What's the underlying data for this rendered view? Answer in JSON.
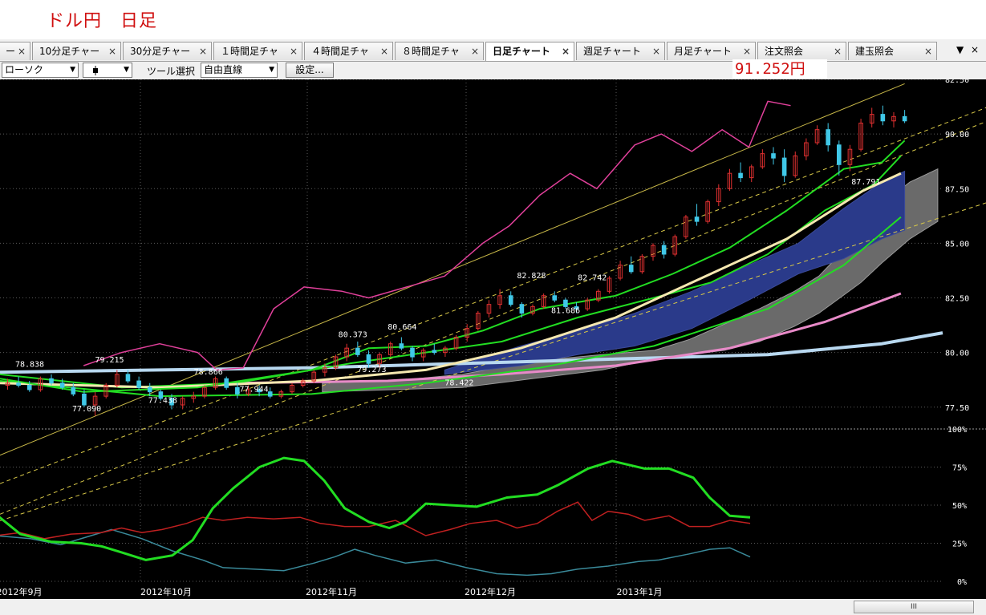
{
  "title": "ドル円　日足",
  "tabs": [
    {
      "label": "ー",
      "close": "×"
    },
    {
      "label": "10分足チャー",
      "close": "×"
    },
    {
      "label": "30分足チャー",
      "close": "×"
    },
    {
      "label": "１時間足チャ",
      "close": "×"
    },
    {
      "label": "４時間足チャ",
      "close": "×"
    },
    {
      "label": "８時間足チャ",
      "close": "×"
    },
    {
      "label": "日足チャート",
      "close": "×"
    },
    {
      "label": "週足チャート",
      "close": "×"
    },
    {
      "label": "月足チャート",
      "close": "×"
    },
    {
      "label": "注文照会",
      "close": "×"
    },
    {
      "label": "建玉照会",
      "close": "×"
    }
  ],
  "tab_menu_icon": "▼",
  "tab_close_all_icon": "×",
  "toolbar": {
    "chart_type": "ローソク",
    "candle_icon": "candlestick-icon",
    "tool_label": "ツール選択",
    "tool_value": "自由直線",
    "settings_label": "設定..."
  },
  "current_price": "91.252円",
  "scrollbar_grip": "III",
  "colors": {
    "bull": "#e03030",
    "bear": "#40c8e8",
    "cloud": "#6a6a6a",
    "band": "#2a3a8a",
    "ma_green": "#22dd22",
    "ma_cream": "#f5e8b0",
    "ma_pink": "#e88ac8",
    "ma_lightblue": "#b8d8f0",
    "rci_line": "#e0409a",
    "trend": "#c8b848",
    "osc_green": "#22dd22",
    "osc_red": "#c02020",
    "osc_teal": "#3a8a9a"
  },
  "chart_data": {
    "type": "line",
    "price_axis": {
      "ticks": [
        "82.50",
        "90.00",
        "87.50",
        "85.00",
        "82.50",
        "80.00",
        "77.50"
      ],
      "range": [
        76.5,
        92.5
      ]
    },
    "osc_axis": {
      "ticks": [
        "100%",
        "75%",
        "50%",
        "25%",
        "0%"
      ],
      "range": [
        0,
        100
      ]
    },
    "x_labels": [
      "2012年9月",
      "2012年10月",
      "2012年11月",
      "2012年12月",
      "2013年1月"
    ],
    "annotations": [
      {
        "text": "78.838",
        "t": 2,
        "v": 79.35
      },
      {
        "text": "79.215",
        "t": 23,
        "v": 79.55
      },
      {
        "text": "77.090",
        "t": 17,
        "v": 77.3
      },
      {
        "text": "78.866",
        "t": 49,
        "v": 79.0
      },
      {
        "text": "77.438",
        "t": 37,
        "v": 77.7
      },
      {
        "text": "77.944",
        "t": 61,
        "v": 78.2
      },
      {
        "text": "80.373",
        "t": 87,
        "v": 80.7
      },
      {
        "text": "80.664",
        "t": 100,
        "v": 81.05
      },
      {
        "text": "79.273",
        "t": 92,
        "v": 79.1
      },
      {
        "text": "78.422",
        "t": 115,
        "v": 78.5
      },
      {
        "text": "82.828",
        "t": 134,
        "v": 83.4
      },
      {
        "text": "82.742",
        "t": 150,
        "v": 83.3
      },
      {
        "text": "81.686",
        "t": 143,
        "v": 81.8
      },
      {
        "text": "87.791",
        "t": 222,
        "v": 87.7
      }
    ],
    "candles_ohlc": [
      [
        78.5,
        78.8,
        78.3,
        78.6
      ],
      [
        78.6,
        78.9,
        78.4,
        78.5
      ],
      [
        78.5,
        78.7,
        78.2,
        78.3
      ],
      [
        78.3,
        78.9,
        78.2,
        78.8
      ],
      [
        78.8,
        79.0,
        78.5,
        78.6
      ],
      [
        78.6,
        78.8,
        78.3,
        78.4
      ],
      [
        78.4,
        78.6,
        78.0,
        78.1
      ],
      [
        78.1,
        78.3,
        77.5,
        77.6
      ],
      [
        77.6,
        78.2,
        77.1,
        78.0
      ],
      [
        78.0,
        78.6,
        77.9,
        78.5
      ],
      [
        78.5,
        79.2,
        78.4,
        79.0
      ],
      [
        79.0,
        79.2,
        78.6,
        78.7
      ],
      [
        78.7,
        78.9,
        78.3,
        78.4
      ],
      [
        78.4,
        78.6,
        78.0,
        78.2
      ],
      [
        78.2,
        78.3,
        77.8,
        77.9
      ],
      [
        77.9,
        78.1,
        77.4,
        77.6
      ],
      [
        77.6,
        78.0,
        77.4,
        77.9
      ],
      [
        77.9,
        78.2,
        77.7,
        78.0
      ],
      [
        78.0,
        78.5,
        77.9,
        78.4
      ],
      [
        78.4,
        78.9,
        78.3,
        78.8
      ],
      [
        78.8,
        78.9,
        78.3,
        78.4
      ],
      [
        78.4,
        78.6,
        77.9,
        78.1
      ],
      [
        78.1,
        78.5,
        78.0,
        78.3
      ],
      [
        78.3,
        78.5,
        78.0,
        78.2
      ],
      [
        78.2,
        78.4,
        77.9,
        78.0
      ],
      [
        78.0,
        78.3,
        77.9,
        78.2
      ],
      [
        78.2,
        78.6,
        78.1,
        78.5
      ],
      [
        78.5,
        78.8,
        78.4,
        78.7
      ],
      [
        78.7,
        79.2,
        78.6,
        79.1
      ],
      [
        79.1,
        79.5,
        78.9,
        79.3
      ],
      [
        79.3,
        79.9,
        79.2,
        79.8
      ],
      [
        79.8,
        80.4,
        79.6,
        80.2
      ],
      [
        80.2,
        80.5,
        79.8,
        79.9
      ],
      [
        79.9,
        80.1,
        79.3,
        79.5
      ],
      [
        79.5,
        80.0,
        79.3,
        79.9
      ],
      [
        79.9,
        80.5,
        79.8,
        80.4
      ],
      [
        80.4,
        80.7,
        80.1,
        80.2
      ],
      [
        80.2,
        80.3,
        79.6,
        79.8
      ],
      [
        79.8,
        80.2,
        79.6,
        80.1
      ],
      [
        80.1,
        80.4,
        79.9,
        80.0
      ],
      [
        80.0,
        80.3,
        79.8,
        80.2
      ],
      [
        80.2,
        80.8,
        80.1,
        80.7
      ],
      [
        80.7,
        81.3,
        80.5,
        81.1
      ],
      [
        81.1,
        81.9,
        81.0,
        81.8
      ],
      [
        81.8,
        82.4,
        81.6,
        82.2
      ],
      [
        82.2,
        82.9,
        82.0,
        82.6
      ],
      [
        82.6,
        82.8,
        82.1,
        82.2
      ],
      [
        82.2,
        82.3,
        81.6,
        81.8
      ],
      [
        81.8,
        82.2,
        81.7,
        82.1
      ],
      [
        82.1,
        82.7,
        82.0,
        82.6
      ],
      [
        82.6,
        82.8,
        82.3,
        82.4
      ],
      [
        82.4,
        82.5,
        82.0,
        82.1
      ],
      [
        82.1,
        82.3,
        81.8,
        82.0
      ],
      [
        82.0,
        82.5,
        81.9,
        82.4
      ],
      [
        82.4,
        82.9,
        82.3,
        82.8
      ],
      [
        82.8,
        83.5,
        82.7,
        83.4
      ],
      [
        83.4,
        84.2,
        83.3,
        84.0
      ],
      [
        84.0,
        84.4,
        83.6,
        83.7
      ],
      [
        83.7,
        84.5,
        83.6,
        84.4
      ],
      [
        84.4,
        85.0,
        84.2,
        84.9
      ],
      [
        84.9,
        85.1,
        84.3,
        84.5
      ],
      [
        84.5,
        85.4,
        84.4,
        85.3
      ],
      [
        85.3,
        86.3,
        85.2,
        86.2
      ],
      [
        86.2,
        86.8,
        85.8,
        86.0
      ],
      [
        86.0,
        87.0,
        85.9,
        86.9
      ],
      [
        86.9,
        87.7,
        86.7,
        87.5
      ],
      [
        87.5,
        88.4,
        87.4,
        88.2
      ],
      [
        88.2,
        88.7,
        87.8,
        88.0
      ],
      [
        88.0,
        88.6,
        87.8,
        88.5
      ],
      [
        88.5,
        89.3,
        88.4,
        89.1
      ],
      [
        89.1,
        89.4,
        88.6,
        88.9
      ],
      [
        88.9,
        89.3,
        87.8,
        88.1
      ],
      [
        88.1,
        89.2,
        88.0,
        89.0
      ],
      [
        89.0,
        89.8,
        88.8,
        89.6
      ],
      [
        89.6,
        90.4,
        89.5,
        90.2
      ],
      [
        90.2,
        90.5,
        89.2,
        89.5
      ],
      [
        89.5,
        89.7,
        88.1,
        88.6
      ],
      [
        88.6,
        89.5,
        88.3,
        89.3
      ],
      [
        89.3,
        90.7,
        89.2,
        90.5
      ],
      [
        90.5,
        91.2,
        90.3,
        90.9
      ],
      [
        90.9,
        91.3,
        90.4,
        90.6
      ],
      [
        90.6,
        91.0,
        90.3,
        90.8
      ],
      [
        90.8,
        91.1,
        90.5,
        90.6
      ]
    ]
  }
}
